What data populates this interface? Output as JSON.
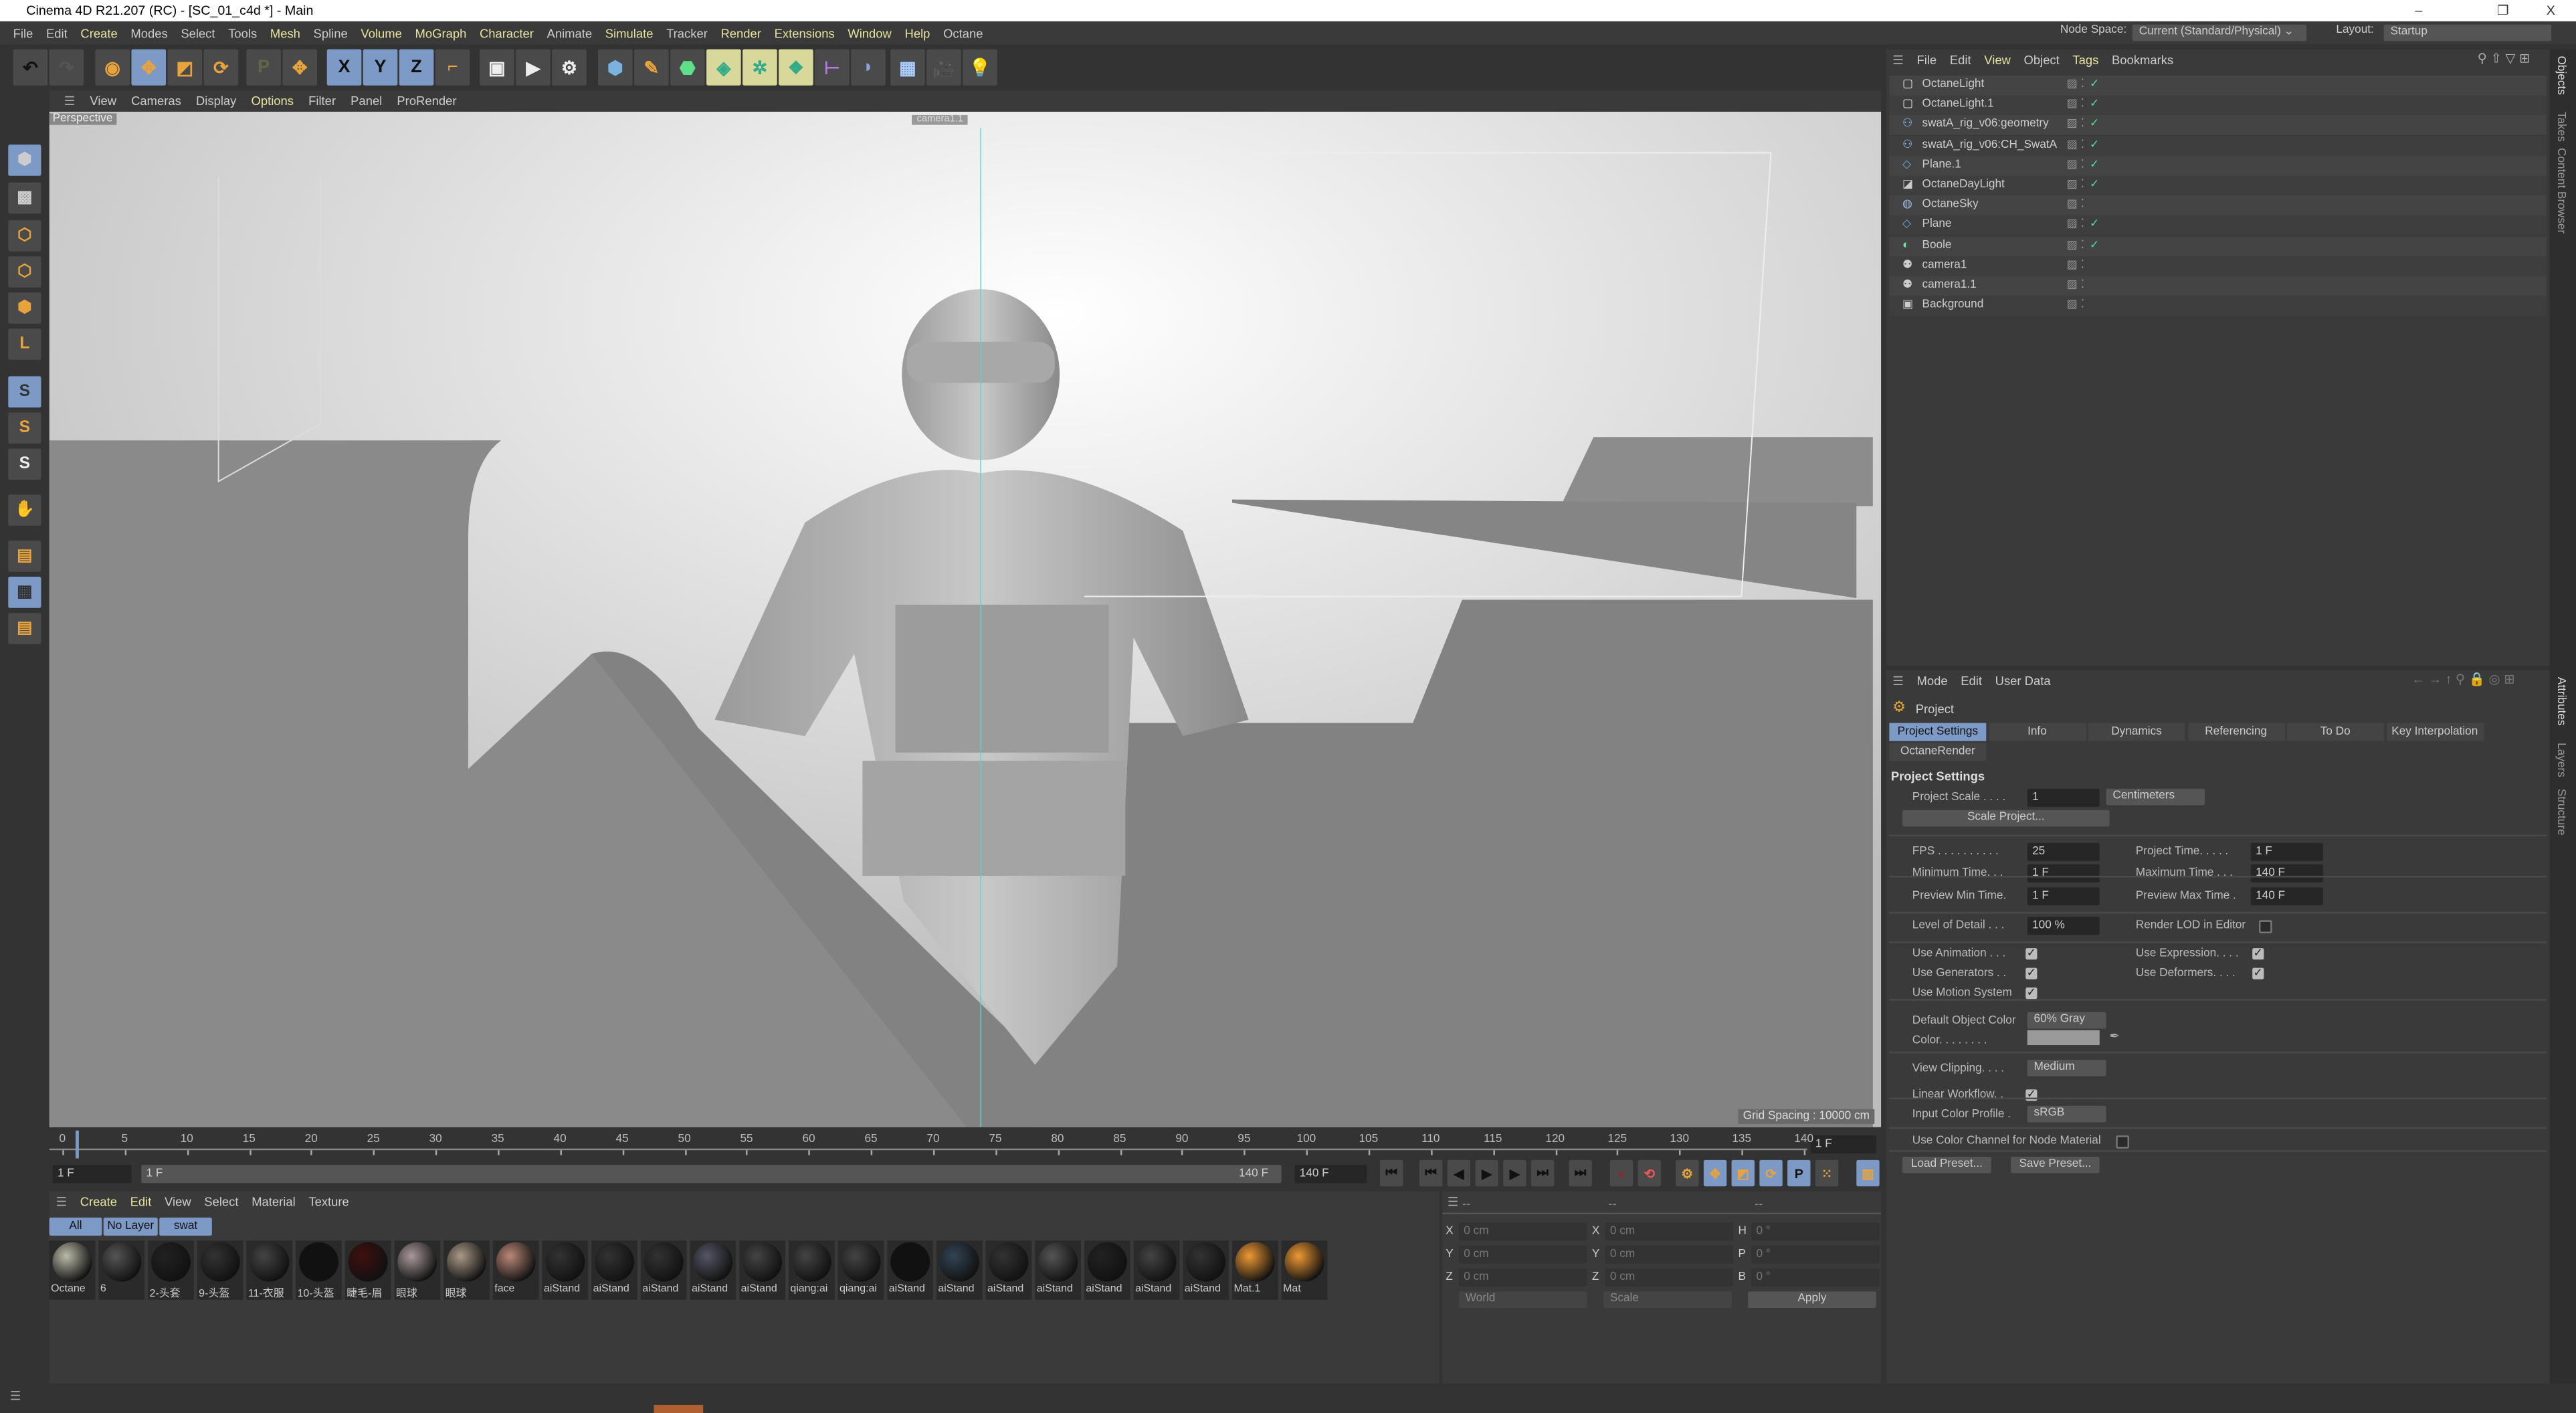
{
  "window": {
    "title": "Cinema 4D R21.207 (RC) - [SC_01_c4d *] - Main",
    "minimize": "–",
    "restore": "❐",
    "close": "X"
  },
  "menu": [
    "File",
    "Edit",
    "Create",
    "Modes",
    "Select",
    "Tools",
    "Mesh",
    "Spline",
    "Volume",
    "MoGraph",
    "Character",
    "Animate",
    "Simulate",
    "Tracker",
    "Render",
    "Extensions",
    "Window",
    "Help",
    "Octane"
  ],
  "node_space": {
    "label": "Node Space:",
    "value": "Current (Standard/Physical)"
  },
  "layout": {
    "label": "Layout:",
    "value": "Startup"
  },
  "toolbar": {
    "x": "X",
    "y": "Y",
    "z": "Z"
  },
  "viewport": {
    "menu": [
      "View",
      "Cameras",
      "Display",
      "Options",
      "Filter",
      "Panel",
      "ProRender"
    ],
    "name": "Perspective",
    "camera_label": "camera1.1",
    "grid_spacing": "Grid Spacing : 10000 cm"
  },
  "timeline": {
    "start": 0,
    "end": 140,
    "step": 5,
    "current_frame": "1 F",
    "min": "1 F",
    "range_start": "1 F",
    "range_end": "140 F",
    "max": "140 F"
  },
  "materials": {
    "menu": [
      "Create",
      "Edit",
      "View",
      "Select",
      "Material",
      "Texture"
    ],
    "layers": [
      "All",
      "No Layer",
      "swat"
    ],
    "items": [
      "Octane",
      "6",
      "2-头套",
      "9-头盔",
      "11-衣服",
      "10-头盔",
      "睫毛-眉",
      "眼球",
      "眼球",
      "face",
      "aiStand",
      "aiStand",
      "aiStand",
      "aiStand",
      "aiStand",
      "qiang:ai",
      "qiang:ai",
      "aiStand",
      "aiStand",
      "aiStand",
      "aiStand",
      "aiStand",
      "aiStand",
      "aiStand",
      "Mat.1",
      "Mat"
    ]
  },
  "coords": {
    "headers": [
      "--",
      "--",
      "--"
    ],
    "rows": [
      [
        "X",
        "0 cm",
        "X",
        "0 cm",
        "H",
        "0 °"
      ],
      [
        "Y",
        "0 cm",
        "Y",
        "0 cm",
        "P",
        "0 °"
      ],
      [
        "Z",
        "0 cm",
        "Z",
        "0 cm",
        "B",
        "0 °"
      ]
    ],
    "world": "World",
    "scale": "Scale",
    "apply": "Apply"
  },
  "objects": {
    "menu": [
      "File",
      "Edit",
      "View",
      "Object",
      "Tags",
      "Bookmarks"
    ],
    "items": [
      "OctaneLight",
      "OctaneLight.1",
      "swatA_rig_v06:geometry",
      "swatA_rig_v06:CH_SwatA",
      "Plane.1",
      "OctaneDayLight",
      "OctaneSky",
      "Plane",
      "Boole",
      "camera1",
      "camera1.1",
      "Background"
    ]
  },
  "side_tabs": {
    "top": [
      "Objects",
      "Takes",
      "Content Browser"
    ],
    "bottom": [
      "Attributes",
      "Layers",
      "Structure"
    ]
  },
  "attributes": {
    "menu": [
      "Mode",
      "Edit",
      "User Data"
    ],
    "object": "Project",
    "tabs": [
      "Project Settings",
      "Info",
      "Dynamics",
      "Referencing",
      "To Do",
      "Key Interpolation",
      "OctaneRender"
    ],
    "section": "Project Settings",
    "project_scale": {
      "label": "Project Scale . . . .",
      "value": "1",
      "unit": "Centimeters"
    },
    "scale_project": "Scale Project...",
    "fps": {
      "label": "FPS . . . . . . . . . .",
      "value": "25"
    },
    "project_time": {
      "label": "Project Time. . . . .",
      "value": "1 F"
    },
    "min_time": {
      "label": "Minimum Time. . .",
      "value": "1 F"
    },
    "max_time": {
      "label": "Maximum Time . . .",
      "value": "140 F"
    },
    "prev_min": {
      "label": "Preview Min Time.",
      "value": "1 F"
    },
    "prev_max": {
      "label": "Preview Max Time .",
      "value": "140 F"
    },
    "lod": {
      "label": "Level of Detail . . .",
      "value": "100 %"
    },
    "render_lod": {
      "label": "Render LOD in Editor",
      "checked": false
    },
    "use_animation": {
      "label": "Use Animation . . .",
      "checked": true
    },
    "use_expression": {
      "label": "Use Expression. . . .",
      "checked": true
    },
    "use_generators": {
      "label": "Use Generators . .",
      "checked": true
    },
    "use_deformers": {
      "label": "Use Deformers. . . .",
      "checked": true
    },
    "use_motion": {
      "label": "Use Motion System",
      "checked": true
    },
    "default_color": {
      "label": "Default Object Color",
      "value": "60% Gray"
    },
    "color": {
      "label": "Color. . . . . . . .",
      "swatch": "#999999"
    },
    "view_clipping": {
      "label": "View Clipping. . . .",
      "value": "Medium"
    },
    "linear_workflow": {
      "label": "Linear Workflow. .",
      "checked": true
    },
    "input_profile": {
      "label": "Input Color Profile .",
      "value": "sRGB"
    },
    "color_channel": {
      "label": "Use Color Channel for Node Material",
      "checked": false
    },
    "load_preset": "Load Preset...",
    "save_preset": "Save Preset..."
  },
  "colors": {
    "accent": "#7d9ac6",
    "highlight": "#e8e3a0",
    "orange": "#e8a33c"
  }
}
